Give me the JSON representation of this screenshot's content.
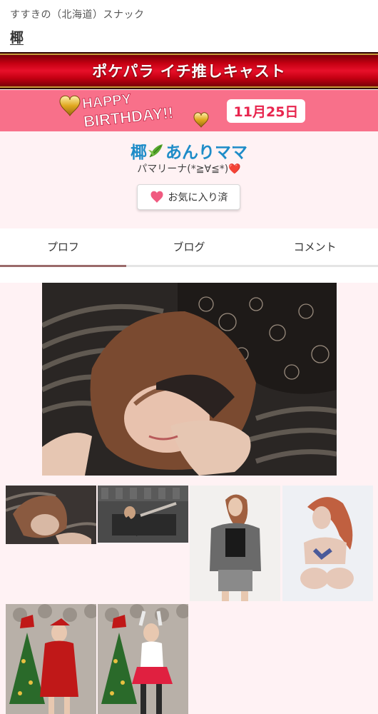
{
  "header": {
    "breadcrumb": "すすきの（北海道）スナック",
    "shop_name": "椰"
  },
  "campaign": {
    "label": "ポケパラ イチ推しキャスト"
  },
  "birthday": {
    "graphic_text_line1": "HAPPY",
    "graphic_text_line2": "BIRTHDAY!!",
    "date": "11月25日"
  },
  "cast": {
    "name_prefix": "椰",
    "leaf_icon": "leaf-icon",
    "name_suffix": "あんりママ",
    "tagline": "パマリーナ(*≧∀≦*)",
    "tagline_emoji": "❤️"
  },
  "favorite_button": {
    "label": "お気に入り済",
    "icon": "heart-icon"
  },
  "tabs": [
    {
      "label": "プロフ",
      "active": true
    },
    {
      "label": "ブログ",
      "active": false
    },
    {
      "label": "コメント",
      "active": false
    }
  ],
  "gallery": {
    "main_photo": {
      "alt": "",
      "palette": [
        "#2a2624",
        "#8a6a52",
        "#e6c6b2"
      ]
    },
    "thumbnails": [
      {
        "palette": [
          "#3a3432",
          "#8a5a40",
          "#d8b8a4"
        ]
      },
      {
        "palette": [
          "#4a4a4a",
          "#2a2a2a",
          "#c8c0b8"
        ]
      },
      {
        "palette": [
          "#f2f0ee",
          "#3a3a3a",
          "#c8a080"
        ]
      },
      {
        "palette": [
          "#eef0f4",
          "#c06040",
          "#e6c8b8"
        ]
      },
      {
        "palette": [
          "#b8b0a8",
          "#c01818",
          "#2a6a2a"
        ]
      },
      {
        "palette": [
          "#b8b0a8",
          "#e02040",
          "#2a6a2a"
        ]
      }
    ]
  },
  "colors": {
    "campaign_red": "#c40012",
    "birthday_pink": "#f8708a",
    "cast_name_blue": "#1e8cc8",
    "profile_bg": "#fff2f4",
    "tab_indicator": "#9a6a6a"
  }
}
